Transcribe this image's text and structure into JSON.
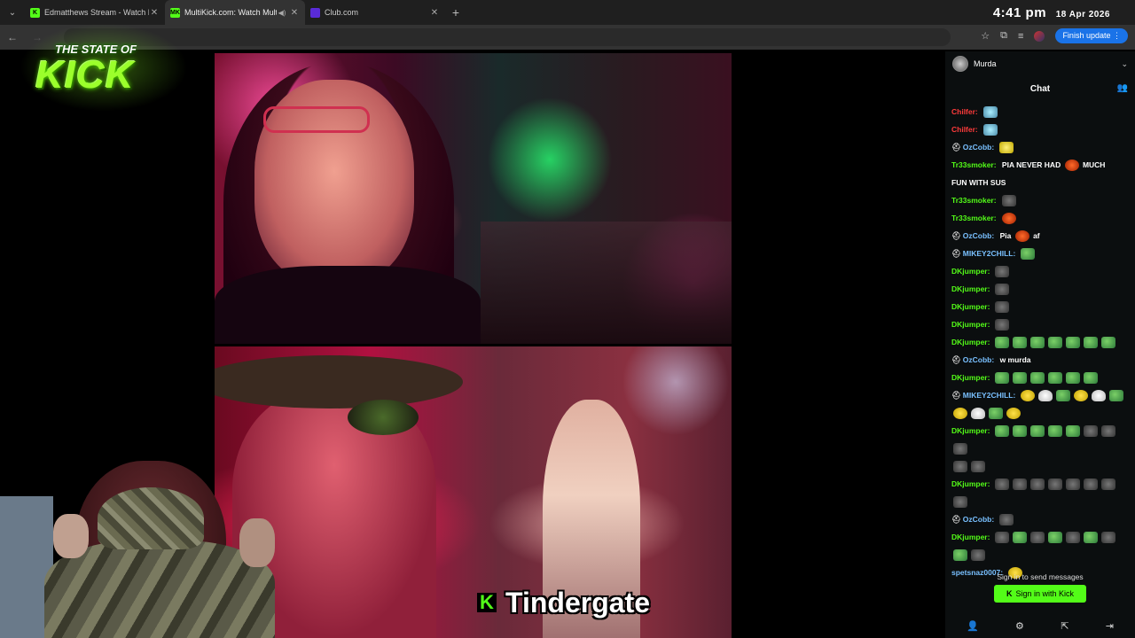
{
  "browser": {
    "tabs": [
      {
        "title": "Edmatthews Stream - Watch Live",
        "favicon": "kick-icon",
        "favicon_color": "#53fc18",
        "active": false
      },
      {
        "title": "MultiKick.com: Watch Multiple",
        "favicon": "multikick-icon",
        "favicon_text": "MK",
        "favicon_color": "#53fc18",
        "active": true
      },
      {
        "title": "Club.com",
        "favicon": "club-icon",
        "favicon_color": "#5a2bd8",
        "active": false
      }
    ],
    "finish_update_label": "Finish update"
  },
  "clock": {
    "time": "4:41 pm",
    "date": "18 Apr 2026"
  },
  "overlay": {
    "logo_top": "THE STATE OF",
    "logo_big": "KICK",
    "caption": "Tindergate",
    "caption_icon": "K"
  },
  "chat": {
    "channel": "Murda",
    "title": "Chat",
    "messages": [
      {
        "user": "Chilfer",
        "color": "#ff3b3b",
        "badge": false,
        "parts": [
          {
            "emote": "cyan"
          }
        ]
      },
      {
        "user": "Chilfer",
        "color": "#ff3b3b",
        "badge": false,
        "parts": [
          {
            "emote": "cyan"
          }
        ]
      },
      {
        "user": "OzCobb",
        "color": "#79c0ff",
        "badge": true,
        "parts": [
          {
            "emote": "pika"
          }
        ]
      },
      {
        "user": "Tr33smoker",
        "color": "#53fc18",
        "badge": false,
        "parts": [
          {
            "text": "PIA NEVER HAD"
          },
          {
            "emote": "red"
          },
          {
            "text": "MUCH"
          }
        ]
      },
      {
        "user": "",
        "color": "#fff",
        "badge": false,
        "parts": [
          {
            "text": "FUN WITH SUS"
          }
        ]
      },
      {
        "user": "Tr33smoker",
        "color": "#53fc18",
        "badge": false,
        "parts": [
          {
            "emote": "dark"
          }
        ]
      },
      {
        "user": "Tr33smoker",
        "color": "#53fc18",
        "badge": false,
        "parts": [
          {
            "emote": "red"
          }
        ]
      },
      {
        "user": "OzCobb",
        "color": "#79c0ff",
        "badge": true,
        "parts": [
          {
            "text": "Pia"
          },
          {
            "emote": "red"
          },
          {
            "text": "af"
          }
        ]
      },
      {
        "user": "MIKEY2CHILL",
        "color": "#79c0ff",
        "badge": true,
        "parts": [
          {
            "emote": "frog"
          }
        ]
      },
      {
        "user": "DKjumper",
        "color": "#53fc18",
        "badge": false,
        "parts": [
          {
            "emote": "dark"
          }
        ]
      },
      {
        "user": "DKjumper",
        "color": "#53fc18",
        "badge": false,
        "parts": [
          {
            "emote": "dark"
          }
        ]
      },
      {
        "user": "DKjumper",
        "color": "#53fc18",
        "badge": false,
        "parts": [
          {
            "emote": "dark"
          }
        ]
      },
      {
        "user": "DKjumper",
        "color": "#53fc18",
        "badge": false,
        "parts": [
          {
            "emote": "dark"
          }
        ]
      },
      {
        "user": "DKjumper",
        "color": "#53fc18",
        "badge": false,
        "parts": [
          {
            "emote": "frog"
          },
          {
            "emote": "frog"
          },
          {
            "emote": "frog"
          },
          {
            "emote": "frog"
          },
          {
            "emote": "frog"
          },
          {
            "emote": "frog"
          },
          {
            "emote": "frog"
          }
        ]
      },
      {
        "user": "OzCobb",
        "color": "#79c0ff",
        "badge": true,
        "parts": [
          {
            "text": "w murda"
          }
        ]
      },
      {
        "user": "DKjumper",
        "color": "#53fc18",
        "badge": false,
        "parts": [
          {
            "emote": "frog"
          },
          {
            "emote": "frog"
          },
          {
            "emote": "frog"
          },
          {
            "emote": "frog"
          },
          {
            "emote": "frog"
          },
          {
            "emote": "frog"
          }
        ]
      },
      {
        "user": "MIKEY2CHILL",
        "color": "#79c0ff",
        "badge": true,
        "parts": [
          {
            "emote": "yel"
          },
          {
            "emote": "ghost"
          },
          {
            "emote": "frog"
          },
          {
            "emote": "yel"
          },
          {
            "emote": "ghost"
          },
          {
            "emote": "frog"
          }
        ]
      },
      {
        "user": "",
        "color": "#fff",
        "badge": false,
        "parts": [
          {
            "emote": "yel"
          },
          {
            "emote": "ghost"
          },
          {
            "emote": "frog"
          },
          {
            "emote": "yel"
          }
        ]
      },
      {
        "user": "DKjumper",
        "color": "#53fc18",
        "badge": false,
        "parts": [
          {
            "emote": "frog"
          },
          {
            "emote": "frog"
          },
          {
            "emote": "frog"
          },
          {
            "emote": "frog"
          },
          {
            "emote": "frog"
          },
          {
            "emote": "dark"
          },
          {
            "emote": "dark"
          },
          {
            "emote": "dark"
          }
        ]
      },
      {
        "user": "",
        "color": "#fff",
        "badge": false,
        "parts": [
          {
            "emote": "dark"
          },
          {
            "emote": "dark"
          }
        ]
      },
      {
        "user": "DKjumper",
        "color": "#53fc18",
        "badge": false,
        "parts": [
          {
            "emote": "dark"
          },
          {
            "emote": "dark"
          },
          {
            "emote": "dark"
          },
          {
            "emote": "dark"
          },
          {
            "emote": "dark"
          },
          {
            "emote": "dark"
          },
          {
            "emote": "dark"
          }
        ]
      },
      {
        "user": "",
        "color": "#fff",
        "badge": false,
        "parts": [
          {
            "emote": "dark"
          }
        ]
      },
      {
        "user": "OzCobb",
        "color": "#79c0ff",
        "badge": true,
        "parts": [
          {
            "emote": "dark"
          }
        ]
      },
      {
        "user": "DKjumper",
        "color": "#53fc18",
        "badge": false,
        "parts": [
          {
            "emote": "dark"
          },
          {
            "emote": "frog"
          },
          {
            "emote": "dark"
          },
          {
            "emote": "frog"
          },
          {
            "emote": "dark"
          },
          {
            "emote": "frog"
          },
          {
            "emote": "dark"
          }
        ]
      },
      {
        "user": "",
        "color": "#fff",
        "badge": false,
        "parts": [
          {
            "emote": "frog"
          },
          {
            "emote": "dark"
          }
        ]
      },
      {
        "user": "spetsnaz0007",
        "color": "#79c0ff",
        "badge": false,
        "parts": [
          {
            "emote": "yel"
          }
        ]
      }
    ],
    "signin_prompt": "Sign in to send messages",
    "signin_button": "Sign in with Kick",
    "accent": "#53fc18"
  }
}
